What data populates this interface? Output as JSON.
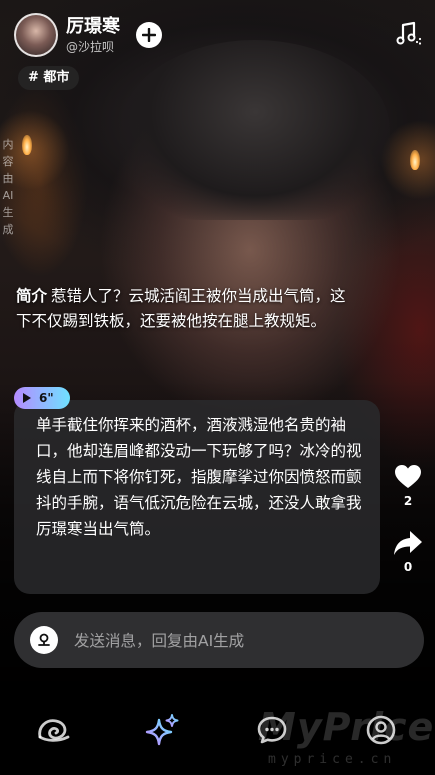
{
  "header": {
    "character_name": "厉璟寒",
    "username": "@沙拉呗",
    "follow_icon": "plus-icon",
    "music_icon": "music-note-icon"
  },
  "tag": "# 都市",
  "ai_note": "内容由AI生成",
  "intro": {
    "label": "简介",
    "text": "惹错人了？云城活阎王被你当成出气筒，这下不仅踢到铁板，还要被他按在腿上教规矩。"
  },
  "voice": {
    "duration": "6\"",
    "icon": "play-icon"
  },
  "message": {
    "text": "单手截住你挥来的酒杯，酒液溅湿他名贵的袖口，他却连眉峰都没动一下玩够了吗？冰冷的视线自上而下将你钉死，指腹摩挲过你因愤怒而颤抖的手腕，语气低沉危险在云城，还没人敢拿我厉璟寒当出气筒。"
  },
  "side_actions": {
    "like_count": "2",
    "share_count": "0",
    "like_icon": "heart-icon",
    "share_icon": "share-arrow-icon"
  },
  "input": {
    "placeholder": "发送消息，回复由AI生成"
  },
  "bottom_nav": {
    "items": [
      "swirl-icon",
      "sparkle-icon",
      "chat-bubble-icon",
      "profile-icon"
    ]
  },
  "watermark": {
    "text": "MyPrice",
    "sub": "myprice.cn"
  }
}
